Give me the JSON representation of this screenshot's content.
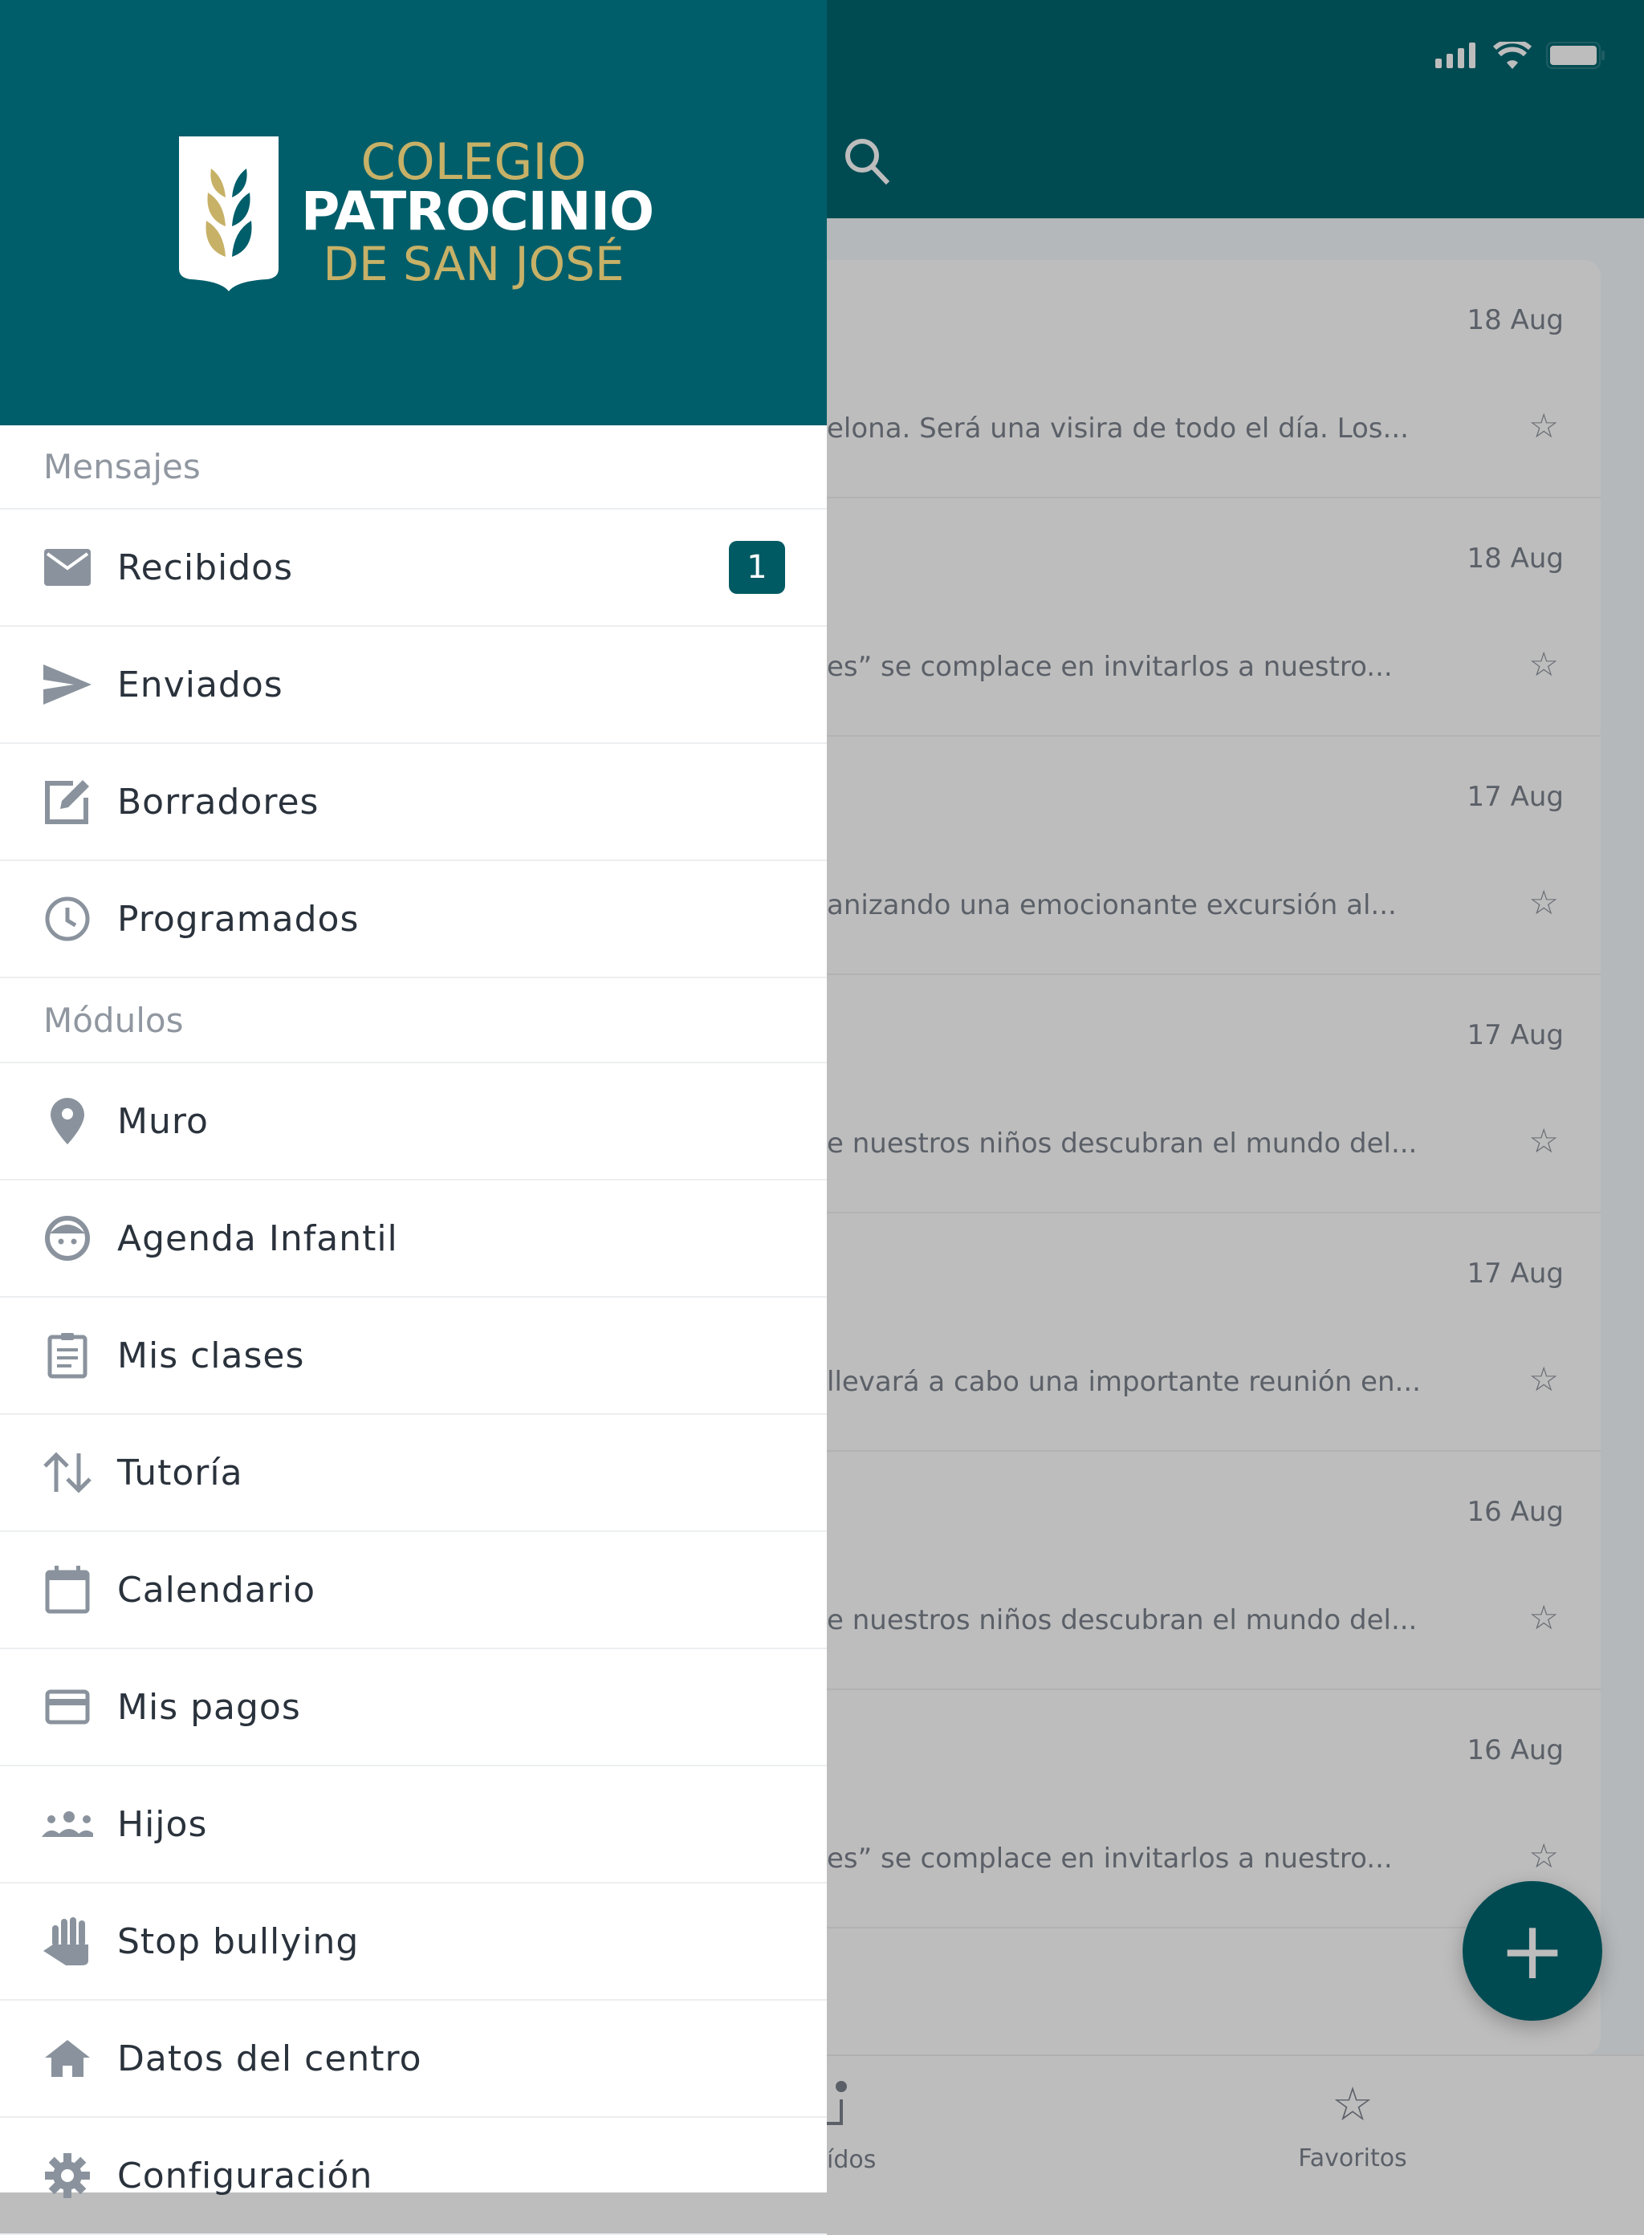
{
  "status": {
    "icons": [
      "signal-icon",
      "wifi-icon",
      "battery-icon"
    ]
  },
  "appbar": {
    "search_icon": "search-icon"
  },
  "messages": [
    {
      "date": "18 Aug",
      "preview": "elona. Será una visira de todo el día. Los..."
    },
    {
      "date": "18 Aug",
      "preview": "es” se complace en invitarlos a nuestro..."
    },
    {
      "date": "17 Aug",
      "preview": "anizando una emocionante excursión al..."
    },
    {
      "date": "17 Aug",
      "preview": "e nuestros niños descubran el mundo del..."
    },
    {
      "date": "17 Aug",
      "preview": "llevará a cabo una importante reunión en..."
    },
    {
      "date": "16 Aug",
      "preview": "e nuestros niños descubran el mundo del..."
    },
    {
      "date": "16 Aug",
      "preview": "es” se complace en invitarlos a nuestro..."
    }
  ],
  "bottom_nav": {
    "left_label": "ídos",
    "favorites_label": "Favoritos"
  },
  "fab": {
    "label": "+"
  },
  "drawer": {
    "logo": {
      "line1": "COLEGIO",
      "line2": "PATROCINIO",
      "line3": "DE SAN JOSÉ"
    },
    "section_messages": "Mensajes",
    "section_modules": "Módulos",
    "message_items": [
      {
        "label": "Recibidos",
        "icon": "mail-icon",
        "badge": "1"
      },
      {
        "label": "Enviados",
        "icon": "send-icon"
      },
      {
        "label": "Borradores",
        "icon": "edit-icon"
      },
      {
        "label": "Programados",
        "icon": "clock-icon"
      }
    ],
    "module_items": [
      {
        "label": "Muro",
        "icon": "location-pin-icon"
      },
      {
        "label": "Agenda Infantil",
        "icon": "child-face-icon"
      },
      {
        "label": "Mis clases",
        "icon": "clipboard-icon"
      },
      {
        "label": "Tutoría",
        "icon": "swap-vertical-icon"
      },
      {
        "label": "Calendario",
        "icon": "calendar-icon"
      },
      {
        "label": "Mis pagos",
        "icon": "credit-card-icon"
      },
      {
        "label": "Hijos",
        "icon": "group-icon"
      },
      {
        "label": "Stop  bullying",
        "icon": "hand-icon"
      },
      {
        "label": "Datos del centro",
        "icon": "home-icon"
      },
      {
        "label": "Configuración",
        "icon": "gear-icon"
      }
    ]
  },
  "colors": {
    "primary": "#005e6a",
    "appbar_dimmed": "#004b52",
    "gold": "#c7b167",
    "badge": "#005a63"
  }
}
